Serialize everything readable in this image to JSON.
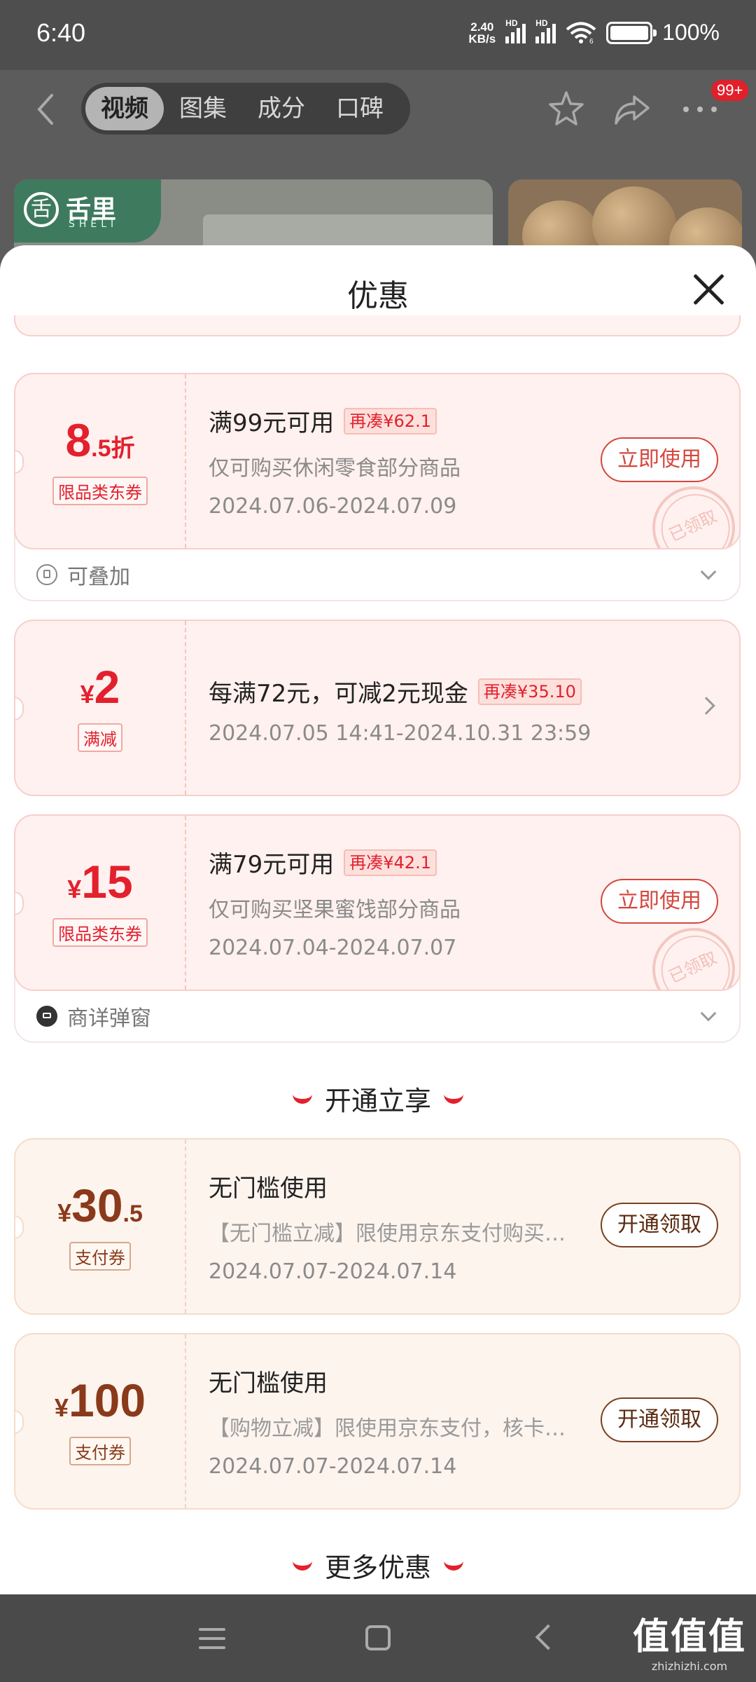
{
  "status_bar": {
    "time": "6:40",
    "net_speed_value": "2.40",
    "net_speed_unit": "KB/s",
    "signal_1_label": "HD",
    "signal_2_label": "HD",
    "wifi_label": "6",
    "battery": "100%"
  },
  "header": {
    "tabs": [
      "视频",
      "图集",
      "成分",
      "口碑"
    ],
    "active_tab": 0,
    "badge": "99+"
  },
  "product_banner": {
    "brand_mark": "舌",
    "brand_name": "舌里",
    "brand_sub": "SHELI"
  },
  "sheet": {
    "title": "优惠",
    "coupons": [
      {
        "currency": "",
        "amount": "8",
        "amount_small": ".5折",
        "tag": "限品类东券",
        "condition": "满99元可用",
        "need_more": "再凑¥62.1",
        "scope": "仅可购买休闲零食部分商品",
        "validity": "2024.07.06-2024.07.09",
        "button": "立即使用",
        "stamp": "已领取",
        "footer": "可叠加"
      },
      {
        "currency": "¥",
        "amount": "2",
        "amount_small": "",
        "tag": "满减",
        "condition": "每满72元，可减2元现金",
        "need_more": "再凑¥35.10",
        "validity": "2024.07.05 14:41-2024.10.31 23:59"
      },
      {
        "currency": "¥",
        "amount": "15",
        "amount_small": "",
        "tag": "限品类东券",
        "condition": "满79元可用",
        "need_more": "再凑¥42.1",
        "scope": "仅可购买坚果蜜饯部分商品",
        "validity": "2024.07.04-2024.07.07",
        "button": "立即使用",
        "stamp": "已领取",
        "footer": "商详弹窗"
      }
    ],
    "section_open": "开通立享",
    "pay_coupons": [
      {
        "currency": "¥",
        "amount": "30",
        "amount_small": ".5",
        "tag": "支付券",
        "condition": "无门槛使用",
        "scope": "【无门槛立减】限使用京东支付购买…",
        "validity": "2024.07.07-2024.07.14",
        "button": "开通领取"
      },
      {
        "currency": "¥",
        "amount": "100",
        "amount_small": "",
        "tag": "支付券",
        "condition": "无门槛使用",
        "scope": "【购物立减】限使用京东支付，核卡…",
        "validity": "2024.07.07-2024.07.14",
        "button": "开通领取"
      }
    ],
    "section_more": "更多优惠"
  },
  "watermark": {
    "text": "值值值",
    "domain": "zhizhizhi.com"
  },
  "colors": {
    "accent_red": "#e3202d",
    "coupon_bg": "#fff1ef",
    "pay_coupon_text": "#8a3a1a"
  }
}
